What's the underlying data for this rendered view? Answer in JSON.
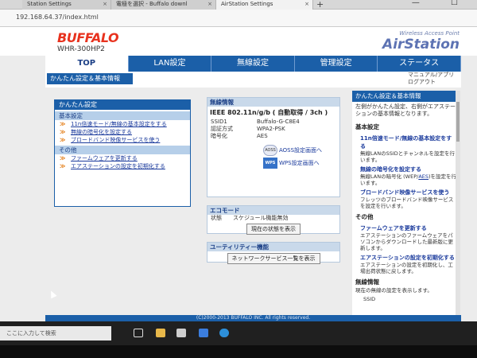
{
  "browser": {
    "tabs": [
      {
        "label": "Station Settings",
        "active": false
      },
      {
        "label": "電極を選択 - Buffalo downl",
        "active": false
      },
      {
        "label": "AirStation Settings",
        "active": true
      }
    ],
    "new_tab": "+",
    "window_buttons": "—  ☐",
    "url": "192.168.64.37/index.html"
  },
  "header": {
    "logo": "BUFFALO",
    "model": "WHR-300HP2",
    "brand_sub": "Wireless Access Point",
    "brand": "AirStation"
  },
  "nav": {
    "items": [
      {
        "label": "TOP",
        "active": true
      },
      {
        "label": "LAN設定",
        "active": false
      },
      {
        "label": "無線設定",
        "active": false
      },
      {
        "label": "管理設定",
        "active": false
      },
      {
        "label": "ステータス",
        "active": false
      }
    ],
    "current_sub": "かんたん設定＆基本情報",
    "right_links": [
      "マニュアル/アプリ",
      "ログアウト"
    ]
  },
  "left_panel": {
    "title": "かんたん設定",
    "basic_heading": "基本設定",
    "basic_links": [
      "11n倍速モード/無線の基本設定をする",
      "無線の暗号化を設定する",
      "ブロードバンド映像サービスを使う"
    ],
    "other_heading": "その他",
    "other_links": [
      "ファームウェアを更新する",
      "エアステーションの設定を初期化する"
    ]
  },
  "wireless_info": {
    "title": "無線情報",
    "mode": "IEEE 802.11n/g/b ( 自動取得 / 3ch )",
    "rows": [
      {
        "k": "SSID1",
        "v": "Buffalo-G-C8E4"
      },
      {
        "k": "認証方式",
        "v": "WPA2-PSK"
      },
      {
        "k": "暗号化",
        "v": "AES"
      }
    ],
    "aoss_icon": "AOSS",
    "aoss_label": "AOSS設定画面へ",
    "wps_icon": "WPS",
    "wps_label": "WPS設定画面へ"
  },
  "eco": {
    "title": "エコモード",
    "status_key": "状態",
    "status_val": "スケジュール機能無効",
    "button": "現在の状態を表示"
  },
  "utility": {
    "title": "ユーティリティー機能",
    "button": "ネットワークサービス一覧を表示"
  },
  "right_panel": {
    "title": "かんたん設定＆基本情報",
    "intro": "左側がかんたん設定、右側がエアステーションの基本情報となります。",
    "basic_heading": "基本設定",
    "items": [
      {
        "sub": "11n倍速モード/無線の基本設定をする",
        "desc": "無線LANのSSIDとチャンネルを設定を行います。"
      },
      {
        "sub": "無線の暗号化を設定する",
        "desc_pre": "無線LANの暗号化 (WEP/",
        "desc_link": "AES",
        "desc_post": ")を設定を行います。"
      },
      {
        "sub": "ブロードバンド映像サービスを使う",
        "desc": "フレッツのブロードバンド映像サービスを設定を行います。"
      }
    ],
    "other_heading": "その他",
    "other_items": [
      {
        "sub": "ファームウェアを更新する",
        "desc": "エアステーションのファームウェアをパソコンからダウンロードした最新版に更新します。"
      },
      {
        "sub": "エアステーションの設定を初期化する",
        "desc": "エアステーションの設定を初期化し、工場出荷状態に戻します。"
      }
    ],
    "wireless_heading": "無線情報",
    "wireless_desc": "現在の無線の設定を表示します。",
    "ssid_label": "SSID"
  },
  "footer": "(C)2000-2013 BUFFALO INC. All rights reserved.",
  "taskbar": {
    "search_placeholder": "ここに入力して検索"
  }
}
